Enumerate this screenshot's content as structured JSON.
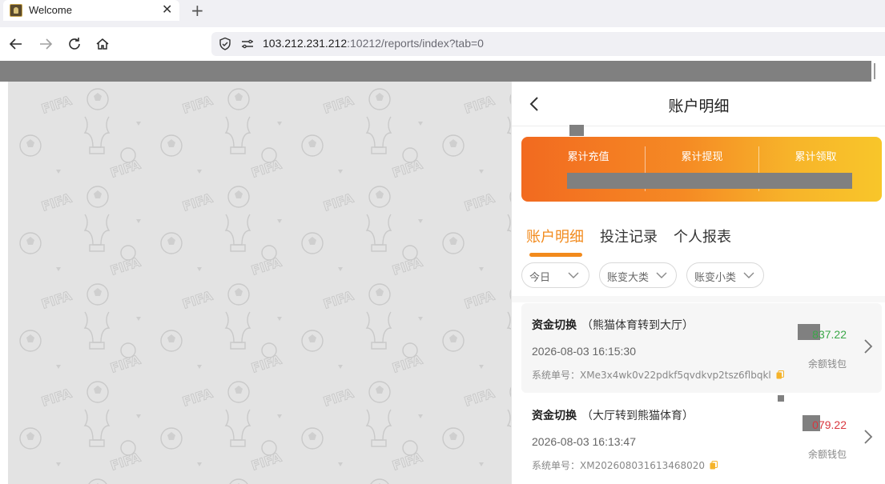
{
  "browser": {
    "tab_title": "Welcome",
    "url_host": "103.212.231.212",
    "url_path": ":10212/reports/index?tab=0"
  },
  "page": {
    "title": "账户明细",
    "stats": [
      "累计充值",
      "累计提现",
      "累计领取"
    ],
    "tabs": [
      "账户明细",
      "投注记录",
      "个人报表"
    ],
    "active_tab": 0,
    "filters": [
      "今日",
      "账变大类",
      "账变小类"
    ],
    "accent_color": "#f28a1c",
    "positive_color": "#3aa748",
    "negative_color": "#d9363e"
  },
  "records": [
    {
      "title": "资金切换",
      "subtitle": "（熊猫体育转到大厅）",
      "time": "2026-08-03 16:15:30",
      "order_label": "系统单号：",
      "order_no": "XMe3x4wk0v22pdkf5qvdkvp2tsz6flbqkl",
      "amount": "837.22",
      "wallet": "余额钱包"
    },
    {
      "title": "资金切换",
      "subtitle": "（大厅转到熊猫体育）",
      "time": "2026-08-03 16:13:47",
      "order_label": "系统单号：",
      "order_no": "XM202608031613468020",
      "amount": "079.22",
      "wallet": "余额钱包"
    }
  ]
}
